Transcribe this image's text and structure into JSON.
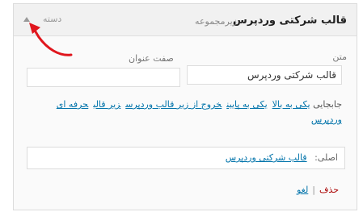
{
  "header": {
    "title": "قالب شرکتی وردپرس",
    "subtitle": "زیرمجموعه",
    "toggle_label": "دسته"
  },
  "form": {
    "text_label": "متن",
    "text_value": "قالب شرکتی وردپرس",
    "title_attr_label": "صفت عنوان",
    "title_attr_value": "",
    "move_label": "جابجایی",
    "move_links": [
      "یکی به بالا",
      "یکی به پایین",
      "خروج از زیر قالب وردپرس",
      "زیر قالب",
      "حرفه ای وردپرس"
    ],
    "original_label": "اصلی:",
    "original_link": "قالب شرکتی وردپرس",
    "delete_label": "حذف",
    "separator": "|",
    "cancel_label": "لغو"
  },
  "colors": {
    "link": "#0073aa",
    "delete": "#aa0000",
    "annotation_arrow": "#e0161d"
  }
}
